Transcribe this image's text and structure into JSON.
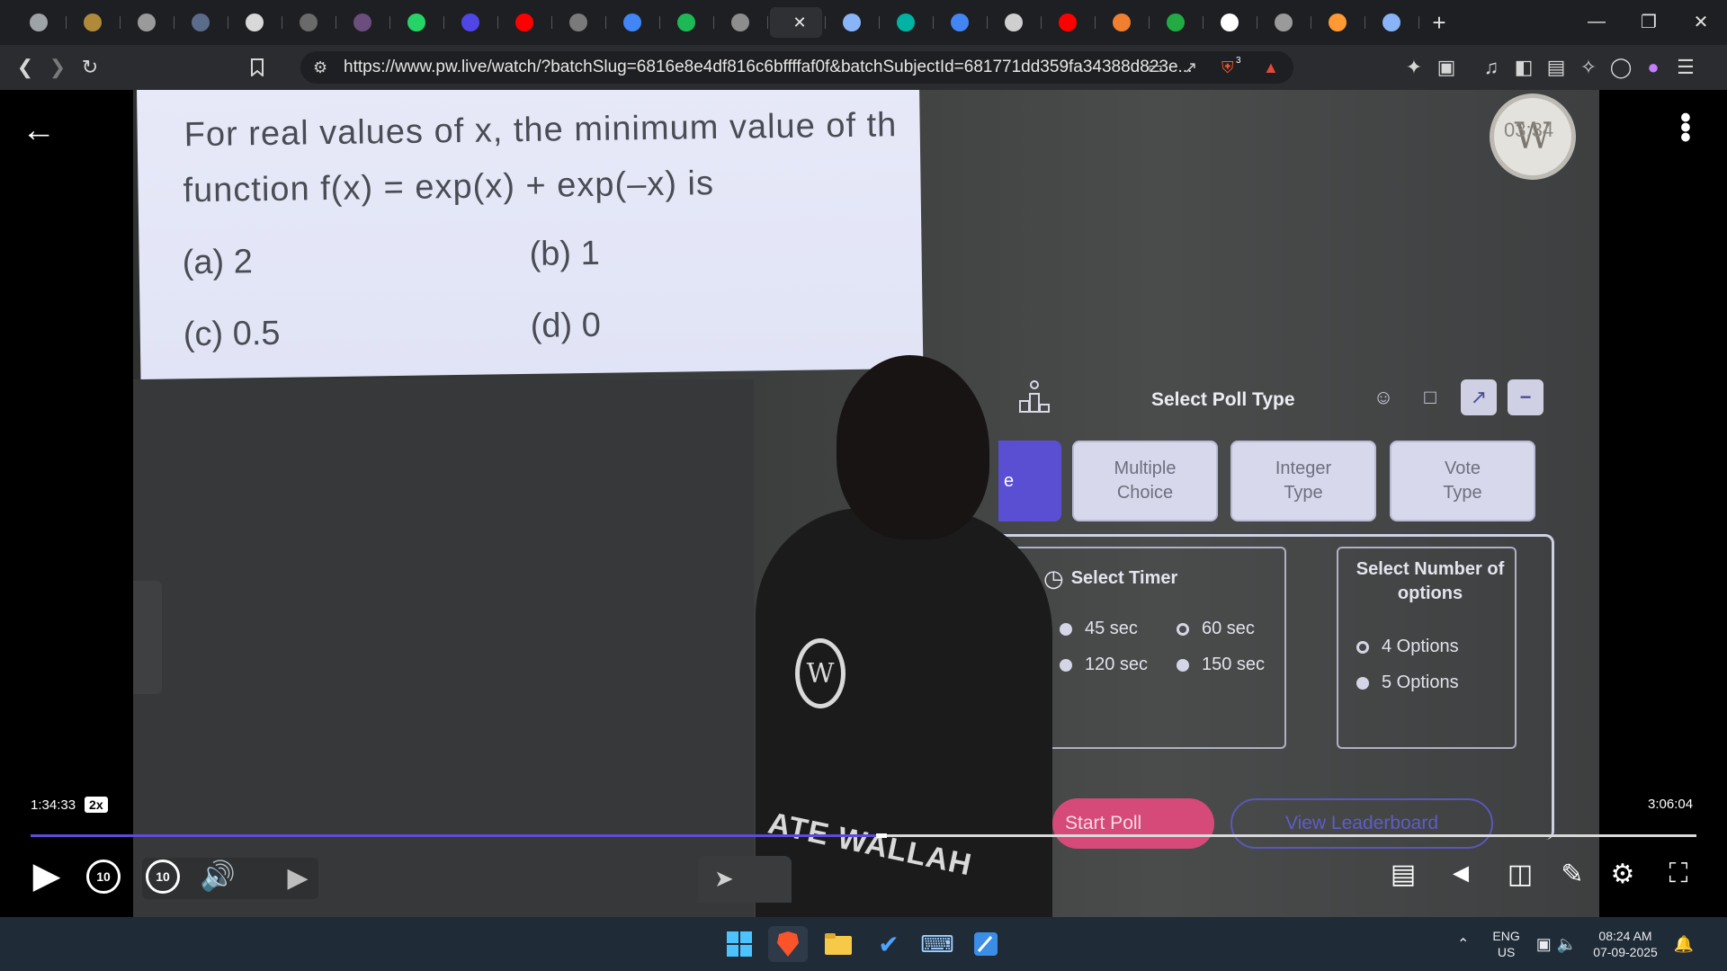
{
  "browser": {
    "url": "https://www.pw.live/watch/?batchSlug=6816e8e4df816c6bffffaf0f&batchSubjectId=681771dd359fa34388d823e...",
    "brave_badge": "3",
    "tab_favicon_colors": [
      "#9ea3a8",
      "#b08a3a",
      "#9a9a9a",
      "#5b6b8a",
      "#d8d8d8",
      "#6a6a6a",
      "#6b4e7e",
      "#25d366",
      "#4f46e5",
      "#ff0000",
      "#7a7a7a",
      "#4285f4",
      "#1db954",
      "#8d8d8d",
      "#9aa0a6",
      "#8ab4f8",
      "#00b3a4",
      "#4285f4",
      "#cfcfcf",
      "#ff0000",
      "#f08030",
      "#22aa44",
      "#ffffff",
      "#9a9a9a",
      "#ff9933",
      "#8ab4f8"
    ]
  },
  "question": {
    "line1": "For real values of x, the minimum value of th",
    "line2": "function f(x) = exp(x) + exp(–x) is",
    "opt_a": "(a)  2",
    "opt_b": "(b)  1",
    "opt_c": "(c)  0.5",
    "opt_d": "(d)  0"
  },
  "logo_overlay": "03:34",
  "poll": {
    "title": "Select Poll Type",
    "active_type_fragment": "e",
    "types": [
      {
        "line1": "Multiple",
        "line2": "Choice"
      },
      {
        "line1": "Integer",
        "line2": "Type"
      },
      {
        "line1": "Vote",
        "line2": "Type"
      }
    ],
    "timer_title": "Select Timer",
    "timer_fragment": "c",
    "timer_options": [
      "45 sec",
      "60 sec",
      "120 sec",
      "150 sec"
    ],
    "selected_timer": "60 sec",
    "options_title_line1": "Select Number of",
    "options_title_line2": "options",
    "option_counts": [
      "4 Options",
      "5 Options"
    ],
    "selected_option_count": "4 Options",
    "start_label": "Start Poll",
    "leaderboard_label": "View Leaderboard"
  },
  "shirt_text": "ATE WALLAH",
  "player": {
    "elapsed": "1:34:33",
    "speed": "2x",
    "duration": "3:06:04",
    "progress_fraction": 0.5078,
    "skip_back": "10",
    "skip_forward": "10"
  },
  "taskbar": {
    "lang_line1": "ENG",
    "lang_line2": "US",
    "time": "08:24 AM",
    "date": "07-09-2025"
  },
  "colors": {
    "accent": "#5f4bd6",
    "start_poll": "#d54a78",
    "leaderboard": "#5f5cc6"
  }
}
